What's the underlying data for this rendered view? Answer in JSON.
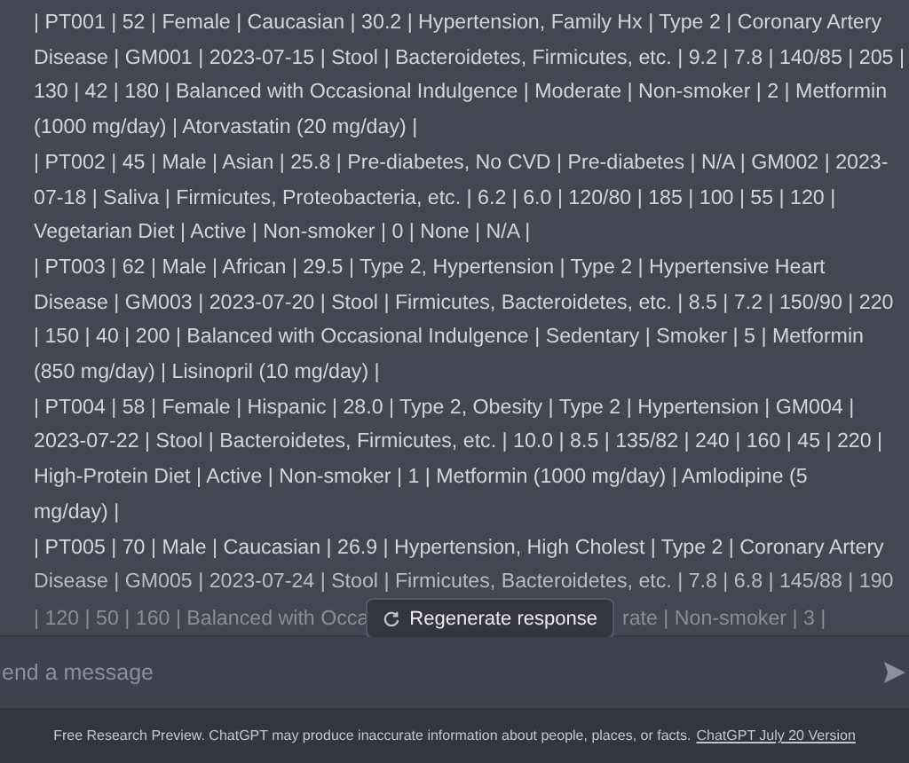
{
  "message": {
    "lines": [
      "| PT001 | 52 | Female | Caucasian | 30.2 | Hypertension, Family Hx | Type 2 | Coronary Artery",
      "Disease | GM001 | 2023-07-15 | Stool | Bacteroidetes, Firmicutes, etc. | 9.2 | 7.8 | 140/85 | 205 |",
      "130 | 42 | 180 | Balanced with Occasional Indulgence | Moderate | Non-smoker | 2 | Metformin",
      "(1000 mg/day) | Atorvastatin (20 mg/day) |",
      "| PT002 | 45 | Male | Asian | 25.8 | Pre-diabetes, No CVD | Pre-diabetes | N/A | GM002 | 2023-",
      "07-18 | Saliva | Firmicutes, Proteobacteria, etc. | 6.2 | 6.0 | 120/80 | 185 | 100 | 55 | 120 |",
      "Vegetarian Diet | Active | Non-smoker | 0 | None | N/A |",
      "| PT003 | 62 | Male | African | 29.5 | Type 2, Hypertension | Type 2 | Hypertensive Heart",
      "Disease | GM003 | 2023-07-20 | Stool | Firmicutes, Bacteroidetes, etc. | 8.5 | 7.2 | 150/90 | 220",
      "| 150 | 40 | 200 | Balanced with Occasional Indulgence | Sedentary | Smoker | 5 | Metformin",
      "(850 mg/day) | Lisinopril (10 mg/day) |",
      "| PT004 | 58 | Female | Hispanic | 28.0 | Type 2, Obesity | Type 2 | Hypertension | GM004 |",
      "2023-07-22 | Stool | Bacteroidetes, Firmicutes, etc. | 10.0 | 8.5 | 135/82 | 240 | 160 | 45 | 220 |",
      "High-Protein Diet | Active | Non-smoker | 1 | Metformin (1000 mg/day) | Amlodipine (5",
      "mg/day) |",
      "| PT005 | 70 | Male | Caucasian | 26.9 | Hypertension, High Cholest | Type 2 | Coronary Artery",
      "Disease | GM005 | 2023-07-24 | Stool | Firmicutes, Bacteroidetes, etc. | 7.8 | 6.8 | 145/88 | 190"
    ],
    "covered_line": {
      "before": "| 120 | 50 | 160 | Balanced with Occa",
      "after": "rate | Non-smoker | 3 |"
    }
  },
  "regenerate_button": {
    "label": "Regenerate response"
  },
  "composer": {
    "placeholder": "end a message"
  },
  "footer": {
    "text": "Free Research Preview. ChatGPT may produce inaccurate information about people, places, or facts.",
    "link": "ChatGPT July 20 Version"
  }
}
